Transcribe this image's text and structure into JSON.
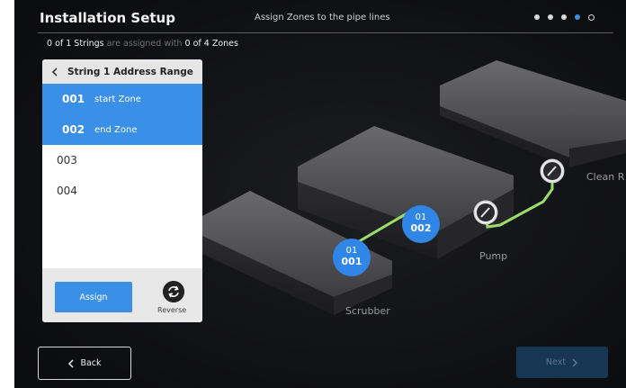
{
  "header": {
    "title": "Installation Setup",
    "subtitle": "Assign Zones to the pipe lines",
    "pager": {
      "total_steps": 5,
      "current_step": 4
    }
  },
  "status": {
    "assigned_count": "0 of 1 Strings",
    "middle_text": "are assigned with",
    "zone_count": "0 of 4 Zones"
  },
  "panel": {
    "title": "String 1 Address Range",
    "rows": [
      {
        "num": "001",
        "label": "start Zone",
        "selected": true
      },
      {
        "num": "002",
        "label": "end Zone",
        "selected": true
      },
      {
        "num": "003",
        "label": "",
        "selected": false
      },
      {
        "num": "004",
        "label": "",
        "selected": false
      }
    ],
    "assign_label": "Assign",
    "reverse_label": "Reverse"
  },
  "scene": {
    "labels": {
      "scrubber": "Scrubber",
      "pump": "Pump",
      "clean": "Clean R"
    },
    "markers": [
      {
        "top": "01",
        "bottom": "001"
      },
      {
        "top": "01",
        "bottom": "002"
      }
    ],
    "pipe_color": "#9bdc6a",
    "marker_color": "#2f86e6"
  },
  "nav": {
    "back_label": "Back",
    "next_label": "Next"
  },
  "colors": {
    "accent": "#3a8fe6",
    "background": "#101114",
    "next_disabled": "#163654"
  }
}
